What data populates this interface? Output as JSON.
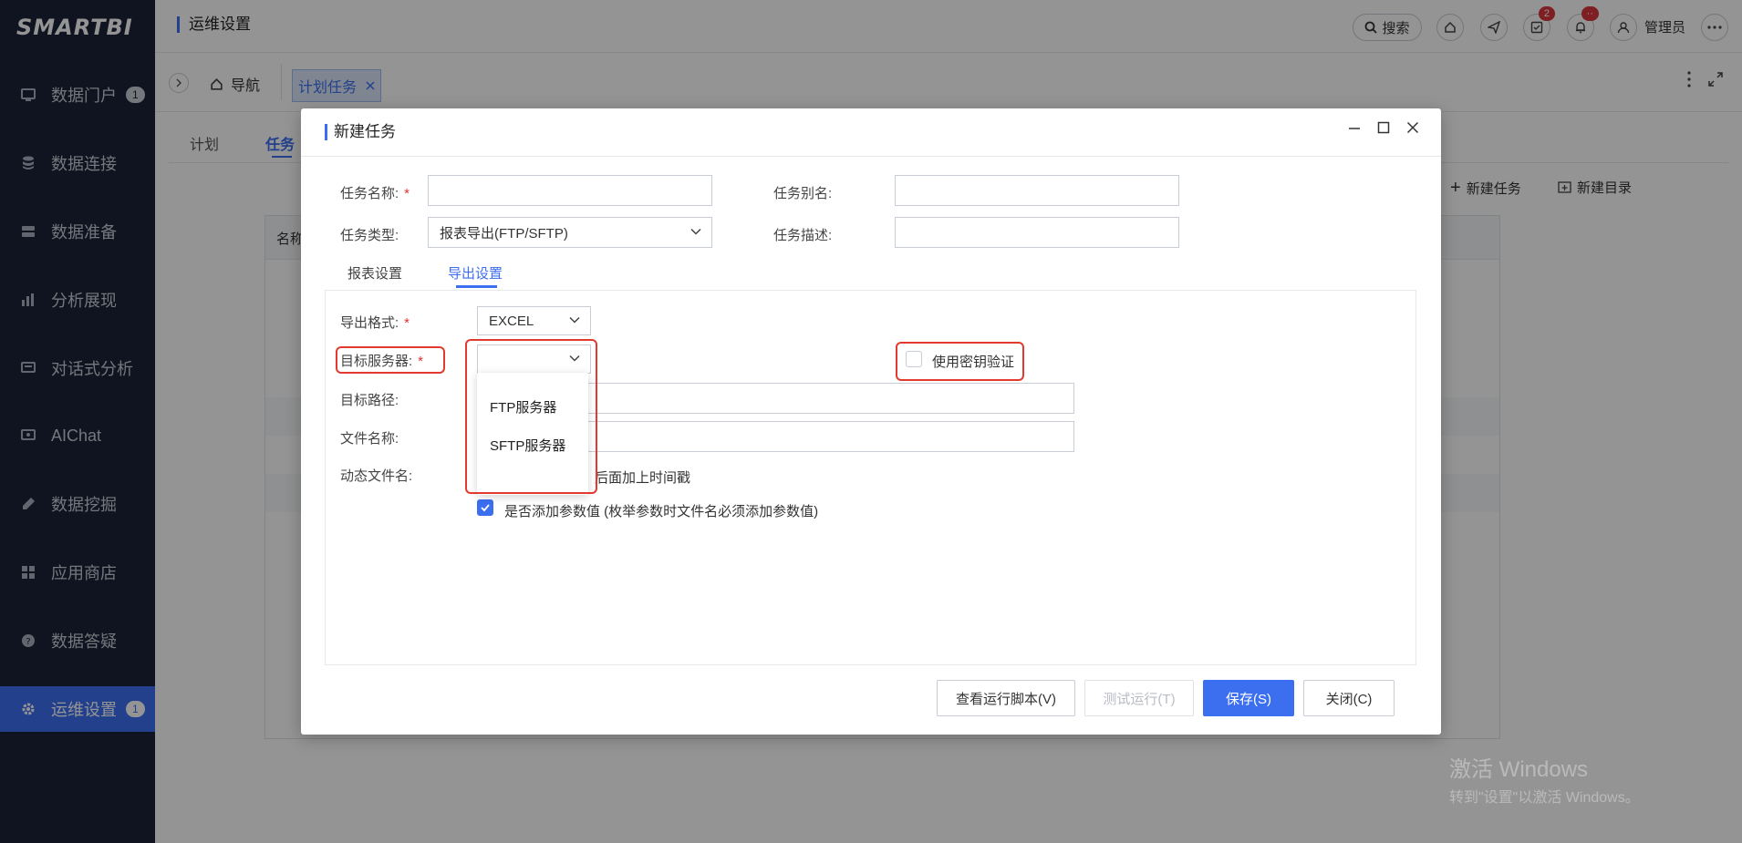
{
  "app": {
    "logo": "SMARTBI",
    "header_title": "运维设置",
    "search_label": "搜索",
    "user": "管理员",
    "task_badge": "2",
    "bell_badge": "··"
  },
  "sidebar": {
    "items": [
      {
        "label": "数据门户",
        "icon": "portal-icon",
        "badge": "1"
      },
      {
        "label": "数据连接",
        "icon": "database-icon"
      },
      {
        "label": "数据准备",
        "icon": "server-icon"
      },
      {
        "label": "分析展现",
        "icon": "bar-chart-icon"
      },
      {
        "label": "对话式分析",
        "icon": "chat-analysis-icon"
      },
      {
        "label": "AIChat",
        "icon": "ai-chat-icon"
      },
      {
        "label": "数据挖掘",
        "icon": "pen-icon"
      },
      {
        "label": "应用商店",
        "icon": "grid-icon"
      },
      {
        "label": "数据答疑",
        "icon": "question-icon"
      },
      {
        "label": "运维设置",
        "icon": "gear-icon",
        "badge": "1",
        "active": true
      }
    ]
  },
  "tabs": {
    "home": "导航",
    "active_tab": "计划任务"
  },
  "background": {
    "tab_plan": "计划",
    "tab_task": "任务",
    "new_task": "新建任务",
    "new_folder": "新建目录",
    "table_col_name": "名称"
  },
  "dialog": {
    "title": "新建任务",
    "fields": {
      "task_name_label": "任务名称:",
      "task_alias_label": "任务别名:",
      "task_type_label": "任务类型:",
      "task_type_value": "报表导出(FTP/SFTP)",
      "task_desc_label": "任务描述:"
    },
    "inner_tabs": {
      "report_settings": "报表设置",
      "export_settings": "导出设置"
    },
    "export": {
      "format_label": "导出格式:",
      "format_value": "EXCEL",
      "server_label": "目标服务器:",
      "server_value": "",
      "server_options": [
        "FTP服务器",
        "SFTP服务器"
      ],
      "path_label": "目标路径:",
      "filename_label": "文件名称:",
      "dynamic_label": "动态文件名:",
      "dynamic_text": "后面加上时间戳",
      "add_param_text": "是否添加参数值 (枚举参数时文件名必须添加参数值)",
      "key_auth_text": "使用密钥验证",
      "add_param_checked": true,
      "key_auth_checked": false
    },
    "buttons": {
      "view_script": "查看运行脚本(V)",
      "test_run": "测试运行(T)",
      "save": "保存(S)",
      "close": "关闭(C)"
    }
  },
  "watermark": {
    "line1": "激活 Windows",
    "line2": "转到\"设置\"以激活 Windows。"
  },
  "colors": {
    "accent": "#3c6ef0",
    "sidebar_bg": "#1c2337",
    "highlight": "#e23a2e"
  }
}
